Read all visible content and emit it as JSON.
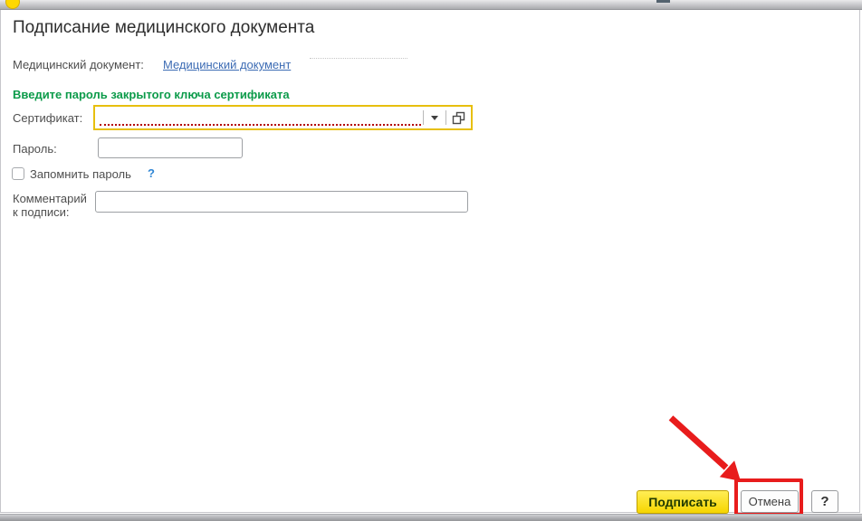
{
  "window": {
    "title": "Подписание медицинского документа"
  },
  "document_row": {
    "label": "Медицинский документ:",
    "link": "Медицинский документ"
  },
  "prompt": "Введите пароль закрытого ключа сертификата",
  "form": {
    "certificate": {
      "label": "Сертификат:",
      "value": "",
      "dropdown_icon": "triangle-down",
      "open_icon": "overlapping-squares"
    },
    "password": {
      "label": "Пароль:",
      "value": ""
    },
    "remember": {
      "label": "Запомнить пароль",
      "checked": false,
      "help": "?"
    },
    "comment": {
      "label_line1": "Комментарий",
      "label_line2": "к подписи:",
      "value": ""
    }
  },
  "footer": {
    "sign": "Подписать",
    "cancel": "Отмена",
    "help": "?"
  },
  "colors": {
    "prompt_green": "#0c9b4a",
    "link_blue": "#3d6cb4",
    "certificate_highlight_yellow": "#e7bf0e",
    "required_underline_red": "#b40000",
    "sign_button_yellow": "#f6d500",
    "sign_button_text_green": "#203a00",
    "annotation_red": "#e81c1c"
  }
}
